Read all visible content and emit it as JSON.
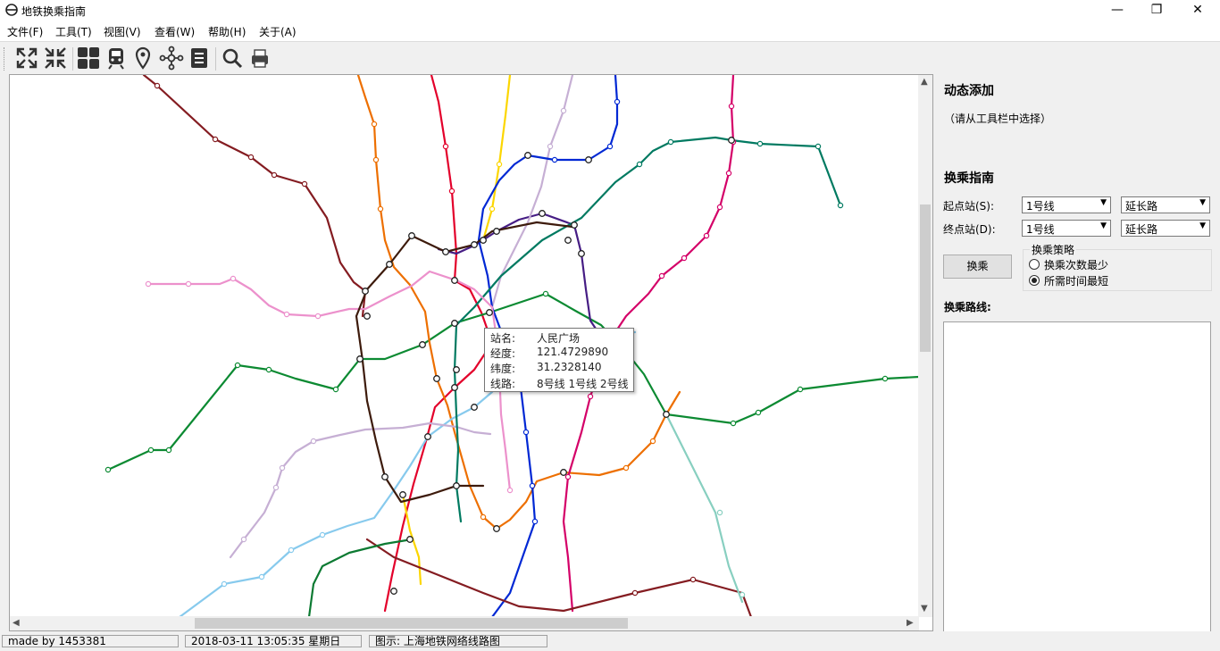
{
  "window": {
    "title": "地铁换乘指南",
    "controls": {
      "minimize": "—",
      "maximize": "❐",
      "close": "✕"
    }
  },
  "menu": [
    "文件(F)",
    "工具(T)",
    "视图(V)",
    "查看(W)",
    "帮助(H)",
    "关于(A)"
  ],
  "toolbar": {
    "buttons": [
      {
        "icon": "expand-icon"
      },
      {
        "icon": "shrink-icon"
      },
      {
        "icon": "grid-icon"
      },
      {
        "icon": "train-icon"
      },
      {
        "icon": "location-pin-icon"
      },
      {
        "icon": "network-icon"
      },
      {
        "icon": "list-icon"
      },
      {
        "icon": "search-icon"
      },
      {
        "icon": "printer-icon"
      }
    ]
  },
  "map": {
    "tooltip": {
      "rows": [
        {
          "key": "站名:",
          "value": "人民广场"
        },
        {
          "key": "经度:",
          "value": "121.4729890"
        },
        {
          "key": "纬度:",
          "value": "31.2328140"
        },
        {
          "key": "线路:",
          "value": "8号线 1号线 2号线"
        }
      ]
    },
    "line_colors": [
      "#e3002b",
      "#8cc220",
      "#fcd600",
      "#461d84",
      "#944d9a",
      "#d40068",
      "#ed6f00",
      "#0094d8",
      "#87caed",
      "#c6afd4",
      "#841c21",
      "#007a61",
      "#ec91cc",
      "#b5a688",
      "#0c7a32",
      "#3d1b0c"
    ]
  },
  "panel": {
    "dynamic_add_title": "动态添加",
    "dynamic_add_hint": "（请从工具栏中选择）",
    "transfer_title": "换乘指南",
    "start_label": "起点站(S):",
    "end_label": "终点站(D):",
    "start_line": "1号线",
    "start_station": "延长路",
    "end_line": "1号线",
    "end_station": "延长路",
    "transfer_button": "换乘",
    "strategy_title": "换乘策略",
    "strategy_options": [
      {
        "label": "换乘次数最少",
        "selected": false
      },
      {
        "label": "所需时间最短",
        "selected": true
      }
    ],
    "route_label": "换乘路线:"
  },
  "status": {
    "author": "made by 1453381",
    "datetime": "2018-03-11 13:05:35 星期日",
    "caption": "图示: 上海地铁网络线路图"
  }
}
